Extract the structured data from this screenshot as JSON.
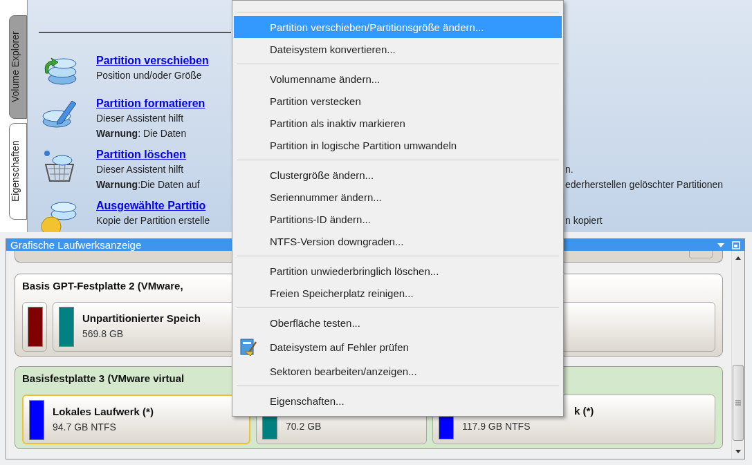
{
  "side_tabs": [
    {
      "label": "Volume Explorer",
      "selected": false
    },
    {
      "label": "Eigenschaften",
      "selected": true
    }
  ],
  "tasks": [
    {
      "title": "Partition verschieben",
      "lines": [
        {
          "text": "Position und/oder Größe"
        }
      ]
    },
    {
      "title": "Partition formatieren",
      "lines": [
        {
          "text": "Dieser Assistent hilft"
        },
        {
          "text": "**Warnung**: Die Daten"
        }
      ]
    },
    {
      "title": "Partition löschen",
      "lines": [
        {
          "text": "Dieser Assistent hilft",
          "tail": "n."
        },
        {
          "text": "**Warnung**:Die Daten auf",
          "tail": "ederherstellen gelöschter Partitionen"
        }
      ]
    },
    {
      "title": "Ausgewählte Partitio",
      "lines": [
        {
          "text": "Kopie der Partition erstelle",
          "tail": "n kopiert"
        }
      ]
    }
  ],
  "disk_panel": {
    "title": "Grafische Laufwerksanzeige",
    "disks": [
      {
        "title": "Basis GPT-Festplatte 2 (VMware,",
        "kind": "gpt",
        "partitions": [
          {
            "color": "#800000",
            "selected": false
          },
          {
            "title": "Unpartitionierter Speich",
            "size": "569.8 GB",
            "color": "#008080",
            "selected": false
          }
        ]
      },
      {
        "title": "Basisfestplatte 3 (VMware virtual",
        "kind": "basic",
        "partitions": [
          {
            "title": "Lokales Laufwerk (*)",
            "size": "94.7 GB NTFS",
            "color": "#0000ff",
            "selected": true
          },
          {
            "size": "70.2 GB",
            "color": "#008080",
            "selected": false
          },
          {
            "title": "k (*)",
            "size": "117.9 GB NTFS",
            "color": "#0000ff",
            "selected": false
          }
        ]
      }
    ]
  },
  "context_menu": {
    "groups": [
      {
        "items": [
          {
            "label": "Partition verschieben/Partitionsgröße ändern...",
            "selected": true,
            "kind": "plain"
          },
          {
            "label": "Dateisystem konvertieren...",
            "selected": false,
            "kind": "plain"
          }
        ]
      },
      {
        "items": [
          {
            "label": "Volumenname ändern...",
            "selected": false,
            "kind": "plain"
          },
          {
            "label": "Partition verstecken",
            "selected": false,
            "kind": "plain"
          },
          {
            "label": "Partition als inaktiv markieren",
            "selected": false,
            "kind": "plain"
          },
          {
            "label": "Partition in logische Partition umwandeln",
            "selected": false,
            "kind": "plain"
          }
        ]
      },
      {
        "items": [
          {
            "label": "Clustergröße ändern...",
            "selected": false,
            "kind": "plain"
          },
          {
            "label": "Seriennummer ändern...",
            "selected": false,
            "kind": "plain"
          },
          {
            "label": "Partitions-ID ändern...",
            "selected": false,
            "kind": "plain"
          },
          {
            "label": "NTFS-Version downgraden...",
            "selected": false,
            "kind": "plain"
          }
        ]
      },
      {
        "items": [
          {
            "label": "Partition unwiederbringlich löschen...",
            "selected": false,
            "kind": "plain"
          },
          {
            "label": "Freien Speicherplatz reinigen...",
            "selected": false,
            "kind": "plain"
          }
        ]
      },
      {
        "items": [
          {
            "label": "Oberfläche testen...",
            "selected": false,
            "kind": "plain"
          },
          {
            "label": "Dateisystem auf Fehler prüfen",
            "selected": false,
            "kind": "icon"
          },
          {
            "label": "Sektoren bearbeiten/anzeigen...",
            "selected": false,
            "kind": "plain"
          }
        ]
      },
      {
        "items": [
          {
            "label": "Eigenschaften...",
            "selected": false,
            "kind": "plain"
          }
        ]
      }
    ]
  }
}
